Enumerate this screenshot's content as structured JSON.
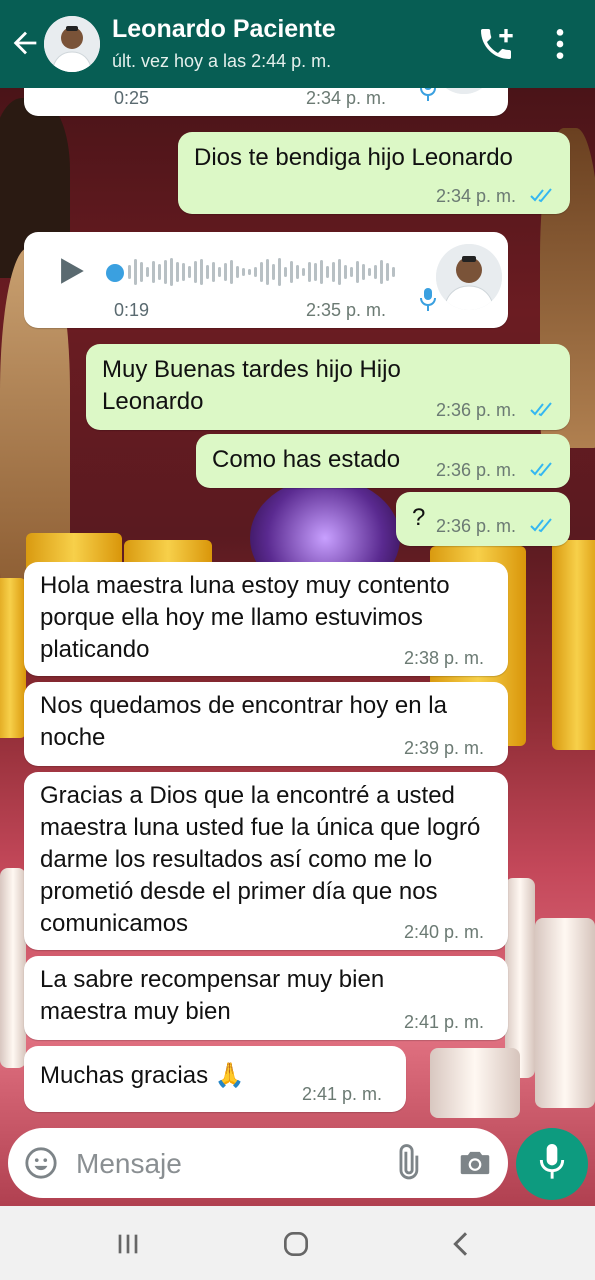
{
  "header": {
    "contact_name": "Leonardo Paciente",
    "last_seen": "últ. vez hoy a las 2:44 p. m."
  },
  "messages": [
    {
      "type": "voice",
      "direction": "incoming",
      "duration": "0:25",
      "time": "2:34 p. m."
    },
    {
      "type": "text",
      "direction": "outgoing",
      "text": "Dios te bendiga hijo Leonardo",
      "time": "2:34 p. m.",
      "status": "read"
    },
    {
      "type": "voice",
      "direction": "incoming",
      "duration": "0:19",
      "time": "2:35 p. m."
    },
    {
      "type": "text",
      "direction": "outgoing",
      "text": "Muy Buenas tardes hijo Hijo Leonardo",
      "time": "2:36 p. m.",
      "status": "read"
    },
    {
      "type": "text",
      "direction": "outgoing",
      "text": "Como has estado",
      "time": "2:36 p. m.",
      "status": "read"
    },
    {
      "type": "text",
      "direction": "outgoing",
      "text": "?",
      "time": "2:36 p. m.",
      "status": "read"
    },
    {
      "type": "text",
      "direction": "incoming",
      "text": "Hola maestra luna estoy muy contento porque ella hoy me llamo estuvimos platicando",
      "time": "2:38 p. m."
    },
    {
      "type": "text",
      "direction": "incoming",
      "text": "Nos quedamos de encontrar hoy en la noche",
      "time": "2:39 p. m."
    },
    {
      "type": "text",
      "direction": "incoming",
      "text": "Gracias a Dios que la encontré a usted maestra luna usted fue la única que logró darme los resultados así como me lo prometió desde el primer día que nos comunicamos",
      "time": "2:40 p. m."
    },
    {
      "type": "text",
      "direction": "incoming",
      "text": "La sabre recompensar muy bien maestra muy bien",
      "time": "2:41 p. m."
    },
    {
      "type": "text",
      "direction": "incoming",
      "text": "Muchas gracias 🙏",
      "time": "2:41 p. m."
    }
  ],
  "input": {
    "placeholder": "Mensaje"
  },
  "icons": {
    "back": "arrow-left-icon",
    "add_call": "add-call-icon",
    "menu": "more-vert-icon",
    "emoji": "emoji-icon",
    "attach": "paperclip-icon",
    "camera": "camera-icon",
    "mic": "mic-icon"
  },
  "colors": {
    "header": "#075e54",
    "outgoing_bubble": "#dcf8c6",
    "incoming_bubble": "#ffffff",
    "read_ticks": "#34b7f1",
    "mic_button": "#0d9b7f"
  }
}
